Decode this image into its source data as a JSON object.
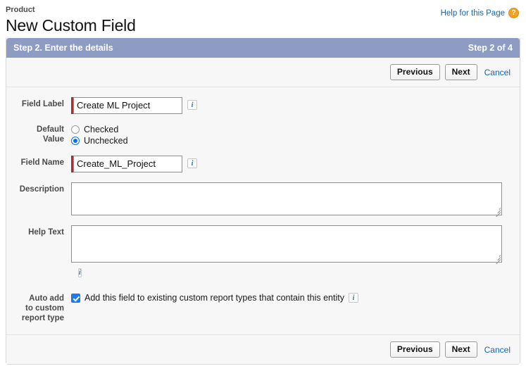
{
  "header": {
    "breadcrumb": "Product",
    "title": "New Custom Field",
    "help_link": "Help for this Page",
    "help_icon": "question-mark-icon"
  },
  "step_bar": {
    "title": "Step 2. Enter the details",
    "counter": "Step 2 of 4"
  },
  "buttons": {
    "previous": "Previous",
    "next": "Next",
    "cancel": "Cancel"
  },
  "form": {
    "field_label": {
      "label": "Field Label",
      "value": "Create ML Project",
      "placeholder": "",
      "required": true,
      "info_icon": "info-icon"
    },
    "default_value": {
      "label_line1": "Default",
      "label_line2": "Value",
      "options": [
        {
          "label": "Checked",
          "selected": false
        },
        {
          "label": "Unchecked",
          "selected": true
        }
      ]
    },
    "field_name": {
      "label": "Field Name",
      "value": "Create_ML_Project",
      "placeholder": "",
      "required": true,
      "info_icon": "info-icon"
    },
    "description": {
      "label": "Description",
      "value": "",
      "placeholder": ""
    },
    "help_text": {
      "label": "Help Text",
      "value": "",
      "placeholder": "",
      "info_icon": "info-icon"
    },
    "auto_add": {
      "label_line1": "Auto add",
      "label_line2": "to custom",
      "label_line3": "report type",
      "checkbox_label": "Add this field to existing custom report types that contain this entity",
      "checked": true,
      "info_icon": "info-icon"
    }
  },
  "colors": {
    "step_bar_bg": "#8e9cc4",
    "link": "#1265b5",
    "required_marker": "#c4232a",
    "accent_blue": "#0b6fe8",
    "help_icon_bg": "#f0a31e",
    "panel_bg": "#f7f7f7"
  }
}
